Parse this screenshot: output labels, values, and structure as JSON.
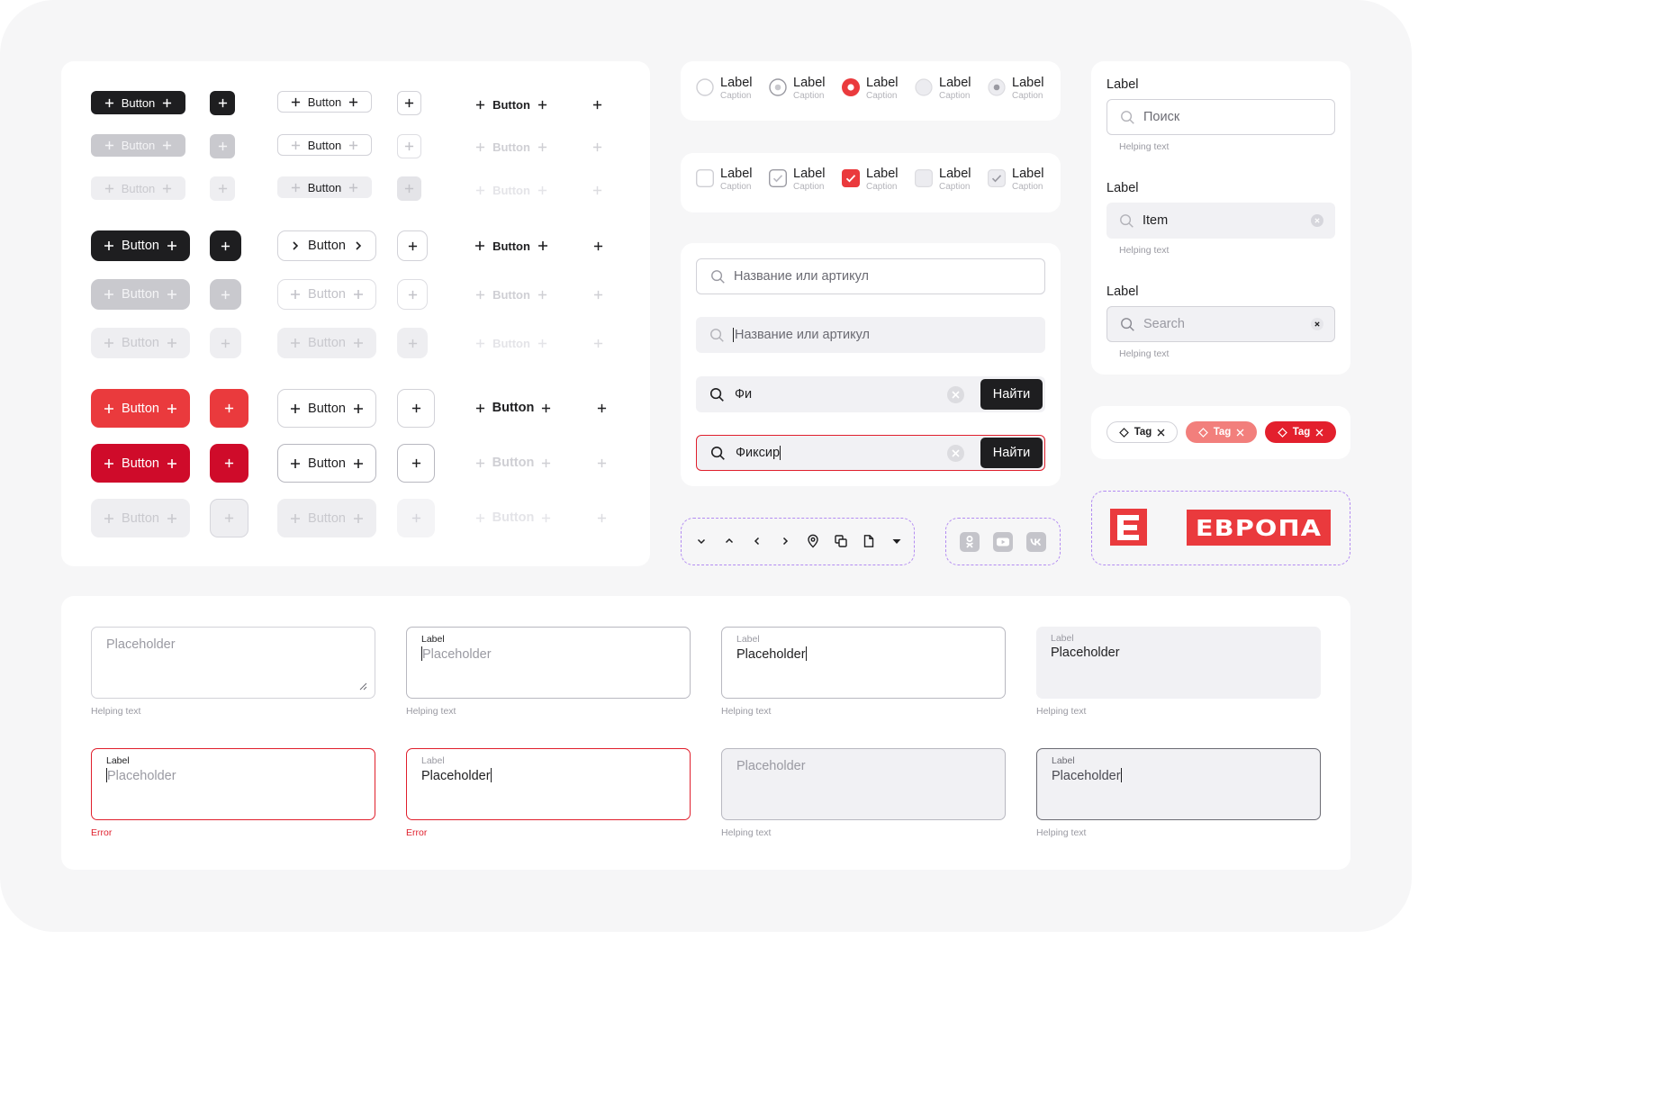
{
  "buttons": {
    "label": "Button"
  },
  "radios": [
    {
      "label": "Label",
      "caption": "Caption",
      "state": "empty"
    },
    {
      "label": "Label",
      "caption": "Caption",
      "state": "hover"
    },
    {
      "label": "Label",
      "caption": "Caption",
      "state": "selected"
    },
    {
      "label": "Label",
      "caption": "Caption",
      "state": "disabled"
    },
    {
      "label": "Label",
      "caption": "Caption",
      "state": "disabled-selected"
    }
  ],
  "checkboxes": [
    {
      "label": "Label",
      "caption": "Caption",
      "state": "empty"
    },
    {
      "label": "Label",
      "caption": "Caption",
      "state": "hover"
    },
    {
      "label": "Label",
      "caption": "Caption",
      "state": "checked"
    },
    {
      "label": "Label",
      "caption": "Caption",
      "state": "disabled"
    },
    {
      "label": "Label",
      "caption": "Caption",
      "state": "disabled-checked"
    }
  ],
  "search_fields": {
    "placeholder": "Название или артикул",
    "typing_value": "Фи",
    "active_value": "Фиксир",
    "submit_label": "Найти"
  },
  "right_fields": [
    {
      "label": "Label",
      "value": "Поиск",
      "help": "Helping text"
    },
    {
      "label": "Label",
      "value": "Item",
      "help": "Helping text"
    },
    {
      "label": "Label",
      "value": "Search",
      "help": "Helping text"
    }
  ],
  "tags": [
    {
      "label": "Tag",
      "variant": "outline"
    },
    {
      "label": "Tag",
      "variant": "light-red"
    },
    {
      "label": "Tag",
      "variant": "red"
    }
  ],
  "nav_icons": [
    "chevron-down-icon",
    "chevron-up-icon",
    "chevron-left-icon",
    "chevron-right-icon",
    "location-pin-icon",
    "copy-icon",
    "file-icon",
    "caret-down-icon"
  ],
  "social_icons": [
    "odnoklassniki-icon",
    "youtube-icon",
    "vk-icon"
  ],
  "logos": {
    "mark": "E",
    "word": "ЕВРОПА"
  },
  "textareas": [
    {
      "label": "",
      "value": "Placeholder",
      "help": "Helping text",
      "state": "empty"
    },
    {
      "label": "Label",
      "value": "Placeholder",
      "help": "Helping text",
      "state": "focus-empty"
    },
    {
      "label": "Label",
      "value": "Placeholder",
      "help": "Helping text",
      "state": "focus-filled"
    },
    {
      "label": "Label",
      "value": "Placeholder",
      "help": "Helping text",
      "state": "filled"
    },
    {
      "label": "Label",
      "value": "Placeholder",
      "help": "Error",
      "state": "error-empty"
    },
    {
      "label": "Label",
      "value": "Placeholder",
      "help": "Error",
      "state": "error-filled"
    },
    {
      "label": "",
      "value": "Placeholder",
      "help": "Helping text",
      "state": "disabled"
    },
    {
      "label": "Label",
      "value": "Placeholder",
      "help": "Helping text",
      "state": "hover-filled"
    }
  ],
  "colors": {
    "accent_red": "#ea3a3d",
    "deep_red": "#cf0b2a",
    "dark": "#1e1e20",
    "dashed_outline": "#b38cf2"
  }
}
